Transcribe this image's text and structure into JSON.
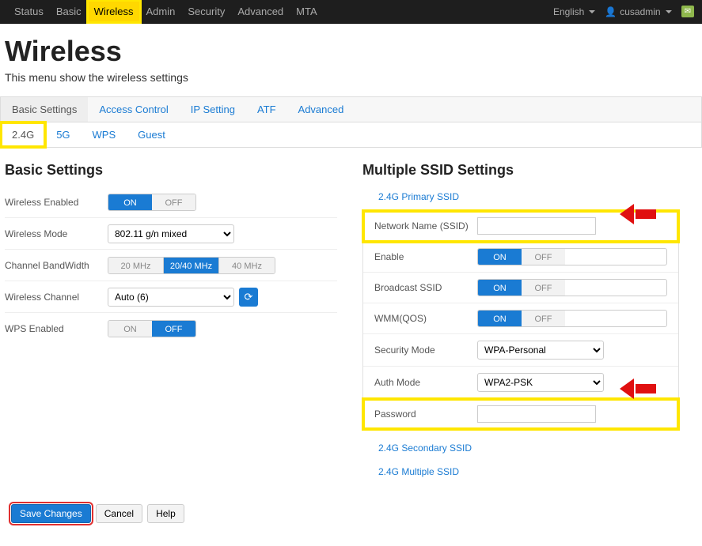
{
  "topnav": {
    "items": [
      "Status",
      "Basic",
      "Wireless",
      "Admin",
      "Security",
      "Advanced",
      "MTA"
    ],
    "active_index": 2,
    "language": "English",
    "username": "cusadmin"
  },
  "page": {
    "title": "Wireless",
    "subtitle": "This menu show the wireless settings"
  },
  "tabs1": {
    "items": [
      "Basic Settings",
      "Access Control",
      "IP Setting",
      "ATF",
      "Advanced"
    ],
    "active_index": 0
  },
  "tabs2": {
    "items": [
      "2.4G",
      "5G",
      "WPS",
      "Guest"
    ],
    "active_index": 0
  },
  "basic": {
    "heading": "Basic Settings",
    "wireless_enabled_label": "Wireless Enabled",
    "wireless_mode_label": "Wireless Mode",
    "wireless_mode_value": "802.11 g/n mixed",
    "channel_bandwidth_label": "Channel BandWidth",
    "bw_options": [
      "20 MHz",
      "20/40 MHz",
      "40 MHz"
    ],
    "wireless_channel_label": "Wireless Channel",
    "wireless_channel_value": "Auto (6)",
    "wps_enabled_label": "WPS Enabled",
    "on_label": "ON",
    "off_label": "OFF"
  },
  "ssid": {
    "heading": "Multiple SSID Settings",
    "primary_link": "2.4G Primary SSID",
    "network_name_label": "Network Name (SSID)",
    "network_name_value": "",
    "enable_label": "Enable",
    "broadcast_label": "Broadcast SSID",
    "wmm_label": "WMM(QOS)",
    "security_mode_label": "Security Mode",
    "security_mode_value": "WPA-Personal",
    "auth_mode_label": "Auth Mode",
    "auth_mode_value": "WPA2-PSK",
    "password_label": "Password",
    "password_value": "",
    "secondary_link": "2.4G Secondary SSID",
    "multiple_link": "2.4G Multiple SSID",
    "on_label": "ON",
    "off_label": "OFF"
  },
  "footer": {
    "save_label": "Save Changes",
    "cancel_label": "Cancel",
    "help_label": "Help"
  }
}
